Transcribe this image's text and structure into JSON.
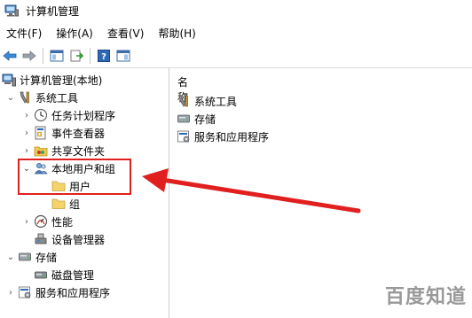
{
  "window": {
    "title": "计算机管理"
  },
  "menu": [
    {
      "label": "文件(F)"
    },
    {
      "label": "操作(A)"
    },
    {
      "label": "查看(V)"
    },
    {
      "label": "帮助(H)"
    }
  ],
  "toolbar": {
    "icons": [
      "back-arrow-icon",
      "forward-arrow-icon",
      "show-hide-tree-icon",
      "export-list-icon",
      "help-icon",
      "properties-pane-icon"
    ]
  },
  "tree": {
    "root": "计算机管理(本地)",
    "system_tools": "系统工具",
    "task_scheduler": "任务计划程序",
    "event_viewer": "事件查看器",
    "shared_folders": "共享文件夹",
    "local_users_groups": "本地用户和组",
    "users": "用户",
    "groups": "组",
    "performance": "性能",
    "device_manager": "设备管理器",
    "storage": "存储",
    "disk_management": "磁盘管理",
    "services_apps": "服务和应用程序"
  },
  "list": {
    "column_header": "名称",
    "items": [
      "系统工具",
      "存储",
      "服务和应用程序"
    ]
  },
  "annotation": {
    "color": "#e0201e"
  },
  "watermark": {
    "text": "百度知道"
  }
}
